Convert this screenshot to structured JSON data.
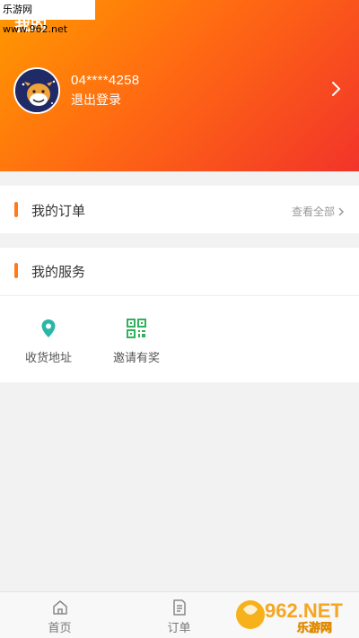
{
  "watermark_top": "乐游网 www.962.net",
  "header": {
    "title": "我的",
    "user_phone": "04****4258",
    "logout_label": "退出登录"
  },
  "orders": {
    "title": "我的订单",
    "view_all_label": "查看全部"
  },
  "services": {
    "title": "我的服务",
    "items": [
      {
        "label": "收货地址",
        "icon": "location-pin-icon"
      },
      {
        "label": "邀请有奖",
        "icon": "qr-code-icon"
      }
    ]
  },
  "tabbar": {
    "tabs": [
      {
        "label": "首页",
        "icon": "home-icon"
      },
      {
        "label": "订单",
        "icon": "document-icon"
      }
    ]
  },
  "watermark_corner": {
    "logo_text": "962.NET",
    "site_name": "乐游网"
  },
  "colors": {
    "header_gradient_start": "#ff9a00",
    "header_gradient_end": "#f2342a",
    "accent": "#ff7a18",
    "location_icon": "#2ab6a8",
    "qr_icon": "#2fb35a"
  }
}
